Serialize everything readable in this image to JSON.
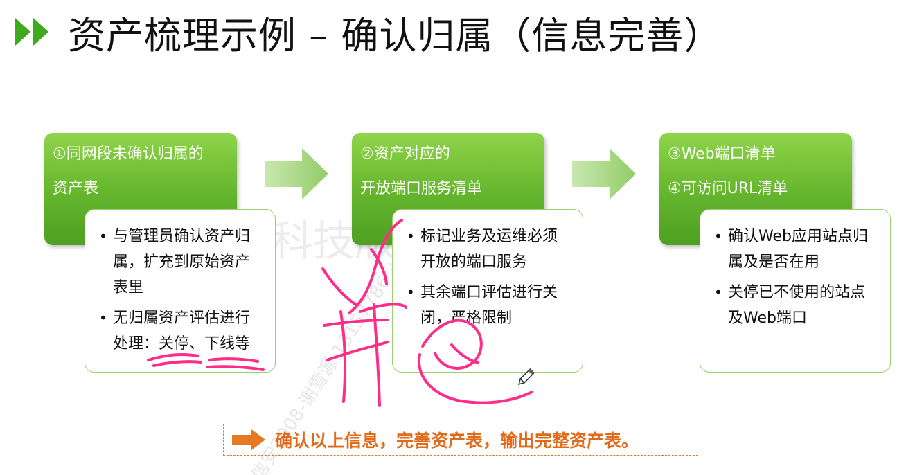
{
  "title": "资产梳理示例 – 确认归属（信息完善）",
  "steps": [
    {
      "header_lines": [
        "①同网段未确认归属的",
        "资产表"
      ],
      "bullets": [
        "与管理员确认资产归属，扩充到原始资产表里",
        "无归属资产评估进行处理：关停、下线等"
      ]
    },
    {
      "header_lines": [
        "②资产对应的",
        "开放端口服务清单"
      ],
      "bullets": [
        "标记业务及运维必须开放的端口服务",
        "其余端口评估进行关闭，严格限制"
      ]
    },
    {
      "header_lines": [
        "③Web端口清单",
        "④可访问URL清单"
      ],
      "bullets": [
        "确认Web应用站点归属及是否在用",
        "关停已不使用的站点及Web端口"
      ]
    }
  ],
  "summary": "确认以上信息，完善资产表，输出完整资产表。",
  "watermark": {
    "main": "绿盟科技版权所有",
    "diagonal": "信安2008-谢雪源 13157786 +8617780961"
  },
  "colors": {
    "green_top": "#8fd44a",
    "green_bottom": "#4f9f22",
    "border_green": "#9ccf6e",
    "summary_orange": "#e26b1a",
    "annotation_pink": "#ff2d8a"
  },
  "icons": {
    "title_marker": "double-chevron-right-icon",
    "flow_arrow": "arrow-right-icon",
    "summary_arrow": "arrow-right-icon",
    "pen_cursor": "pencil-icon"
  }
}
